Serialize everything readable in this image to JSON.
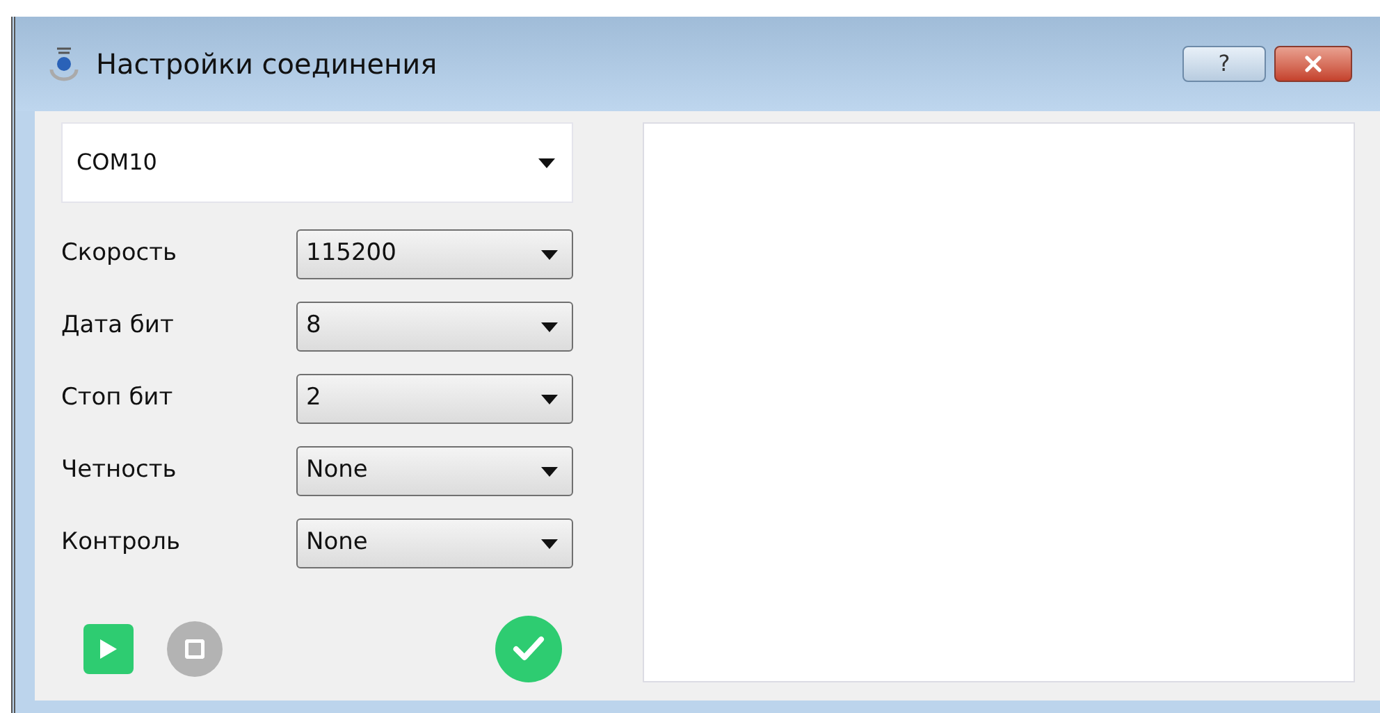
{
  "window": {
    "title": "Настройки соединения",
    "help_button": "?"
  },
  "port": {
    "value": "COM10"
  },
  "settings": [
    {
      "label": "Скорость",
      "value": "115200"
    },
    {
      "label": "Дата бит",
      "value": "8"
    },
    {
      "label": "Стоп бит",
      "value": "2"
    },
    {
      "label": "Четность",
      "value": "None"
    },
    {
      "label": "Контроль",
      "value": "None"
    }
  ],
  "actions": [
    {
      "kind": "play",
      "disabled": false
    },
    {
      "kind": "stop",
      "disabled": true
    },
    {
      "kind": "confirm",
      "disabled": false
    }
  ]
}
